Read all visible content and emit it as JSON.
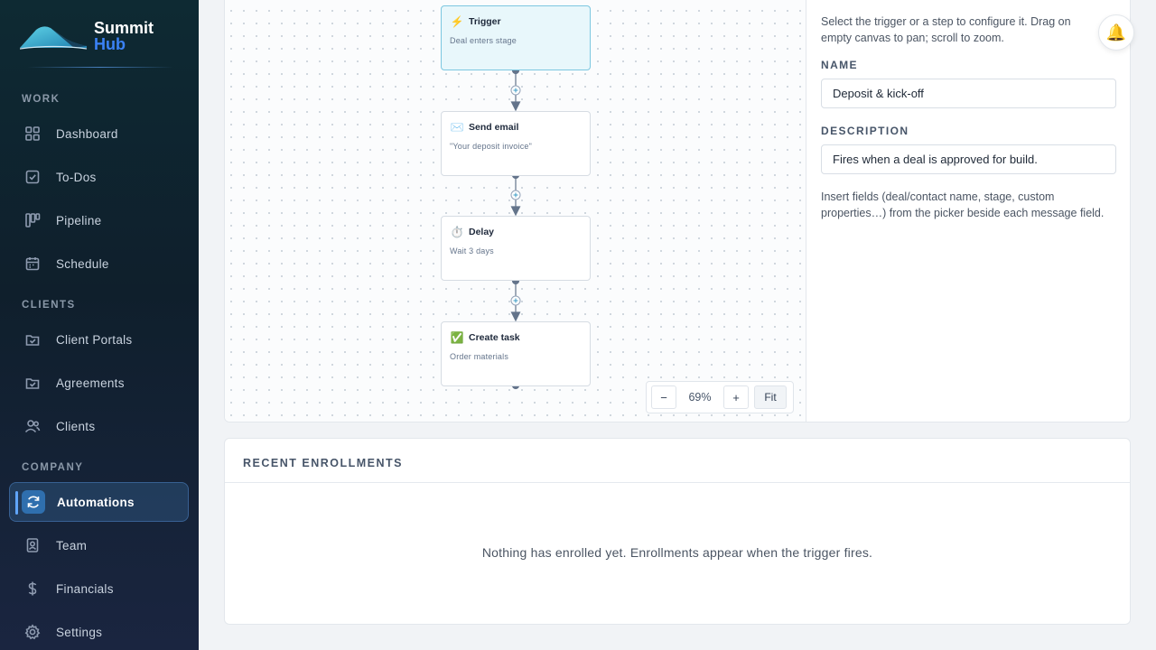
{
  "brand": {
    "name_line1": "Summit",
    "name_line2": "Hub",
    "accent": "#3b82f6"
  },
  "sidebar": {
    "sections": [
      {
        "label": "WORK",
        "items": [
          {
            "label": "Dashboard",
            "icon": "grid-icon"
          },
          {
            "label": "To-Dos",
            "icon": "checkbox-icon"
          },
          {
            "label": "Pipeline",
            "icon": "kanban-icon"
          },
          {
            "label": "Schedule",
            "icon": "calendar-icon"
          }
        ]
      },
      {
        "label": "CLIENTS",
        "items": [
          {
            "label": "Client Portals",
            "icon": "portal-icon"
          },
          {
            "label": "Agreements",
            "icon": "document-check-icon"
          },
          {
            "label": "Clients",
            "icon": "users-icon"
          }
        ]
      },
      {
        "label": "COMPANY",
        "items": [
          {
            "label": "Automations",
            "icon": "refresh-icon",
            "active": true
          },
          {
            "label": "Team",
            "icon": "badge-icon"
          },
          {
            "label": "Financials",
            "icon": "dollar-icon"
          },
          {
            "label": "Settings",
            "icon": "gear-icon"
          }
        ]
      }
    ]
  },
  "flow": {
    "nodes": [
      {
        "title": "Trigger",
        "subtitle": "Deal enters stage",
        "icon": "lightning-icon",
        "glyph": "⚡",
        "selected": true
      },
      {
        "title": "Send email",
        "subtitle": "\"Your deposit invoice\"",
        "icon": "envelope-icon",
        "glyph": "✉️"
      },
      {
        "title": "Delay",
        "subtitle": "Wait 3 days",
        "icon": "stopwatch-icon",
        "glyph": "⏱️"
      },
      {
        "title": "Create task",
        "subtitle": "Order materials",
        "icon": "check-mark-icon",
        "glyph": "✅"
      }
    ],
    "zoom": {
      "minus": "−",
      "value": "69%",
      "plus": "+",
      "fit": "Fit"
    }
  },
  "panel": {
    "hint": "Select the trigger or a step to configure it. Drag on empty canvas to pan; scroll to zoom.",
    "name_label": "NAME",
    "name_value": "Deposit & kick-off",
    "description_label": "DESCRIPTION",
    "description_value": "Fires when a deal is approved for build.",
    "help": "Insert fields (deal/contact name, stage, custom properties…) from the picker beside each message field."
  },
  "enrollments": {
    "title": "RECENT ENROLLMENTS",
    "empty": "Nothing has enrolled yet. Enrollments appear when the trigger fires."
  },
  "bell": {
    "icon": "bell-icon",
    "glyph": "🔔"
  }
}
